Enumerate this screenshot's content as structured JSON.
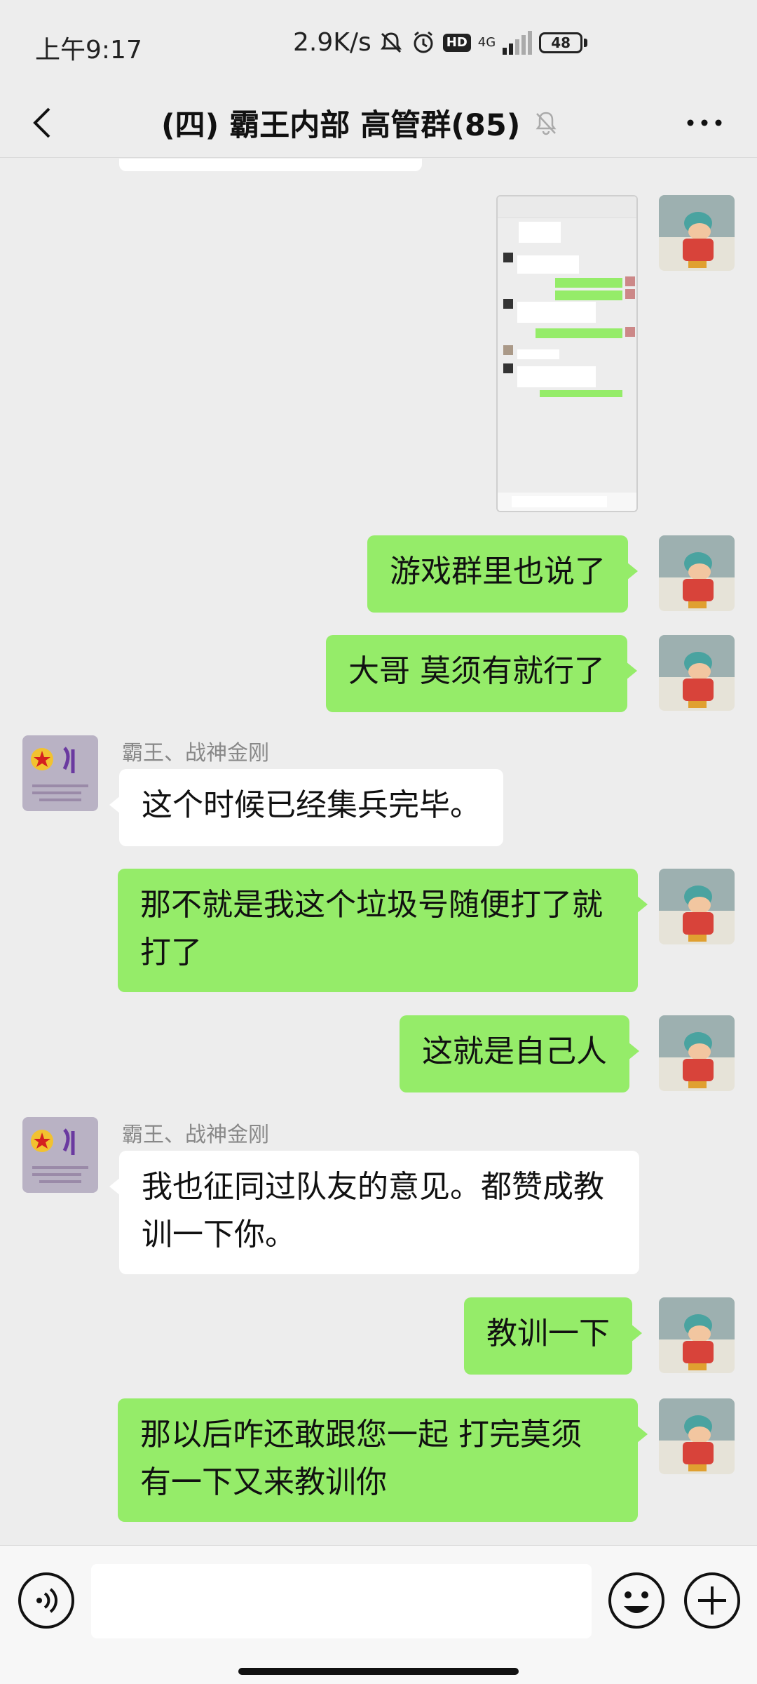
{
  "status_bar": {
    "time": "上午9:17",
    "net_speed": "2.9K/s",
    "hd": "HD",
    "network_type": "4G",
    "battery": "48"
  },
  "nav": {
    "title": "(四) 霸王内部 高管群(85)",
    "back_icon": "chevron-left-icon",
    "mute_icon": "bell-muted-icon",
    "more_icon": "more-dots-icon"
  },
  "messages": [
    {
      "type": "image",
      "from": "me",
      "description_icon": "screenshot-image"
    },
    {
      "type": "text",
      "from": "me",
      "text": "游戏群里也说了"
    },
    {
      "type": "text",
      "from": "me",
      "text": "大哥 莫须有就行了"
    },
    {
      "type": "text",
      "from": "other",
      "sender": "霸王、战神金刚",
      "text": "这个时候已经集兵完毕。"
    },
    {
      "type": "text",
      "from": "me",
      "lines": [
        "那不就是我这个垃圾号随便打了就",
        "打了"
      ]
    },
    {
      "type": "text",
      "from": "me",
      "text": "这就是自己人"
    },
    {
      "type": "text",
      "from": "other",
      "sender": "霸王、战神金刚",
      "lines": [
        "我也征同过队友的意见。都赞成教",
        "训一下你。"
      ]
    },
    {
      "type": "text",
      "from": "me",
      "text": "教训一下"
    },
    {
      "type": "text",
      "from": "me",
      "lines": [
        "那以后咋还敢跟您一起 打完莫须",
        "有一下又来教训你"
      ]
    }
  ],
  "input_bar": {
    "voice_icon": "voice-icon",
    "emoji_icon": "emoji-icon",
    "add_icon": "plus-icon",
    "placeholder": ""
  },
  "colors": {
    "my_bubble": "#95ec69",
    "other_bubble": "#ffffff",
    "background": "#ededed"
  }
}
